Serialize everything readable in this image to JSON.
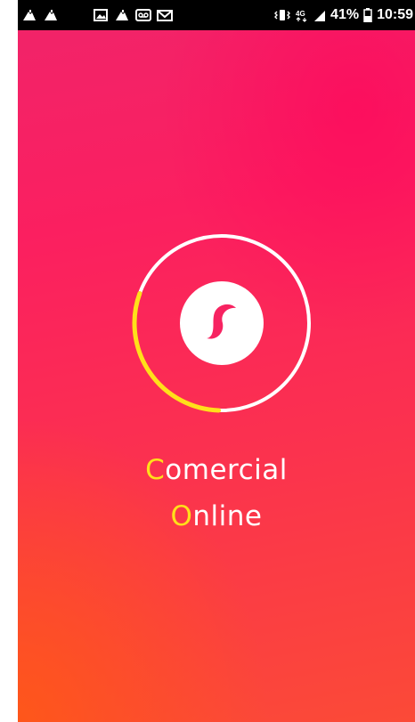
{
  "status_bar": {
    "battery_percent": "41%",
    "time": "10:59",
    "network": "4G",
    "icons": [
      "app-notification-icon",
      "app-notification-icon",
      "image-icon",
      "app-notification-icon",
      "voicemail-icon",
      "mail-icon",
      "vibrate-icon",
      "4g-icon",
      "signal-icon",
      "battery-icon"
    ]
  },
  "splash": {
    "brand_line1_initial": "C",
    "brand_line1_rest": "omercial",
    "brand_line2_initial": "O",
    "brand_line2_rest": "nline",
    "loading_progress": 0.3
  },
  "colors": {
    "background_top": "#f0246a",
    "background_bottom": "#fb4a37",
    "accent_yellow": "#ffe01a",
    "foreground": "#ffffff"
  }
}
